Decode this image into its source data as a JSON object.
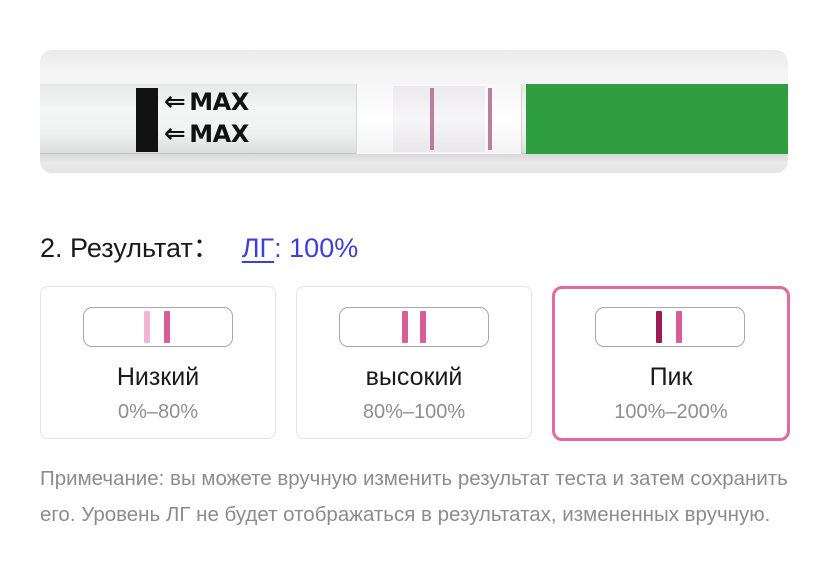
{
  "photo": {
    "strip_marks": [
      "MAX",
      "MAX"
    ],
    "colors": {
      "handle": "#2e9e40",
      "test_line": "#b06a8c"
    }
  },
  "result": {
    "prefix": "2. Результат：",
    "link_text": "ЛГ",
    "value_suffix": ": 100%",
    "accent_color": "#3c3fd8"
  },
  "options": [
    {
      "label": "Низкий",
      "range": "0%–80%",
      "selected": false,
      "bars": [
        {
          "color": "#f0b6d2"
        },
        {
          "color": "#d85e96"
        }
      ]
    },
    {
      "label": "высокий",
      "range": "80%–100%",
      "selected": false,
      "bars": [
        {
          "color": "#d85e96"
        },
        {
          "color": "#d85e96"
        }
      ]
    },
    {
      "label": "Пик",
      "range": "100%–200%",
      "selected": true,
      "bars": [
        {
          "color": "#9c1d55"
        },
        {
          "color": "#d85e96"
        }
      ]
    }
  ],
  "selected_border_color": "#e26a9c",
  "note": "Примечание: вы можете вручную изменить результат теста и затем сохранить его. Уровень ЛГ не будет отображаться в результатах, измененных вручную."
}
